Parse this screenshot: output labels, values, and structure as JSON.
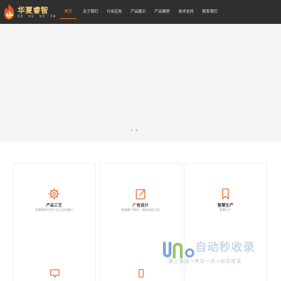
{
  "brand": {
    "title": "华夏睿智",
    "subtitle": "智造 · 精益 · 品质 · 共赢"
  },
  "nav": [
    {
      "label": "首页",
      "active": true
    },
    {
      "label": "关于我们",
      "active": false
    },
    {
      "label": "行业应用",
      "active": false
    },
    {
      "label": "产品展示",
      "active": false
    },
    {
      "label": "产品案例",
      "active": false
    },
    {
      "label": "技术支持",
      "active": false
    },
    {
      "label": "联系我们",
      "active": false
    }
  ],
  "hero": {
    "slide_count": 2,
    "active_slide": 2
  },
  "features": [
    {
      "title": "产品工艺",
      "desc": "苦眼智能打的产品工艺和客户",
      "icon": "gear-icon"
    },
    {
      "title": "广告设计",
      "desc": "根据客户需求，做出优越方案",
      "icon": "edit-icon"
    },
    {
      "title": "智慧生产",
      "desc": "智慧生产",
      "icon": "bookmark-icon"
    }
  ],
  "watermark": {
    "title": "自动秒收录",
    "subtitle": "做上链接→来访一次→自动收录"
  },
  "colors": {
    "header_bg": "#2f2f2f",
    "accent": "#e8702a",
    "logo_gold": "#f1d27a"
  }
}
